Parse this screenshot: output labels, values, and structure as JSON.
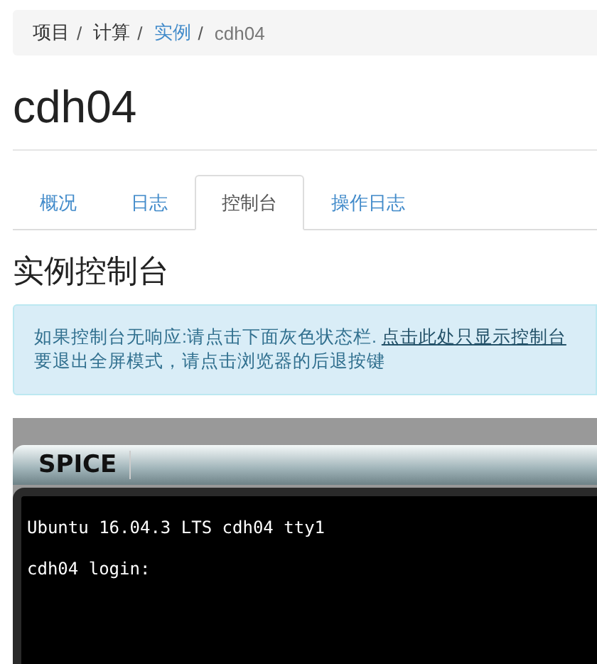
{
  "breadcrumb": [
    {
      "label": "项目",
      "kind": "text",
      "separator": "/"
    },
    {
      "label": "计算",
      "kind": "text",
      "separator": "/"
    },
    {
      "label": "实例",
      "kind": "link",
      "separator": "/"
    },
    {
      "label": "cdh04",
      "kind": "current"
    }
  ],
  "page_title": "cdh04",
  "tabs": [
    {
      "label": "概况",
      "selected": false
    },
    {
      "label": "日志",
      "selected": false
    },
    {
      "label": "控制台",
      "selected": true
    },
    {
      "label": "操作日志",
      "selected": false
    }
  ],
  "section_title": "实例控制台",
  "alert": {
    "text": "如果控制台无响应:请点击下面灰色状态栏.",
    "link": "点击此处只显示控制台",
    "second_line": "要退出全屏模式，请点击浏览器的后退按键"
  },
  "console": {
    "toolbar_title": "SPICE",
    "lines": [
      "Ubuntu 16.04.3 LTS cdh04 tty1",
      "cdh04 login:"
    ]
  }
}
